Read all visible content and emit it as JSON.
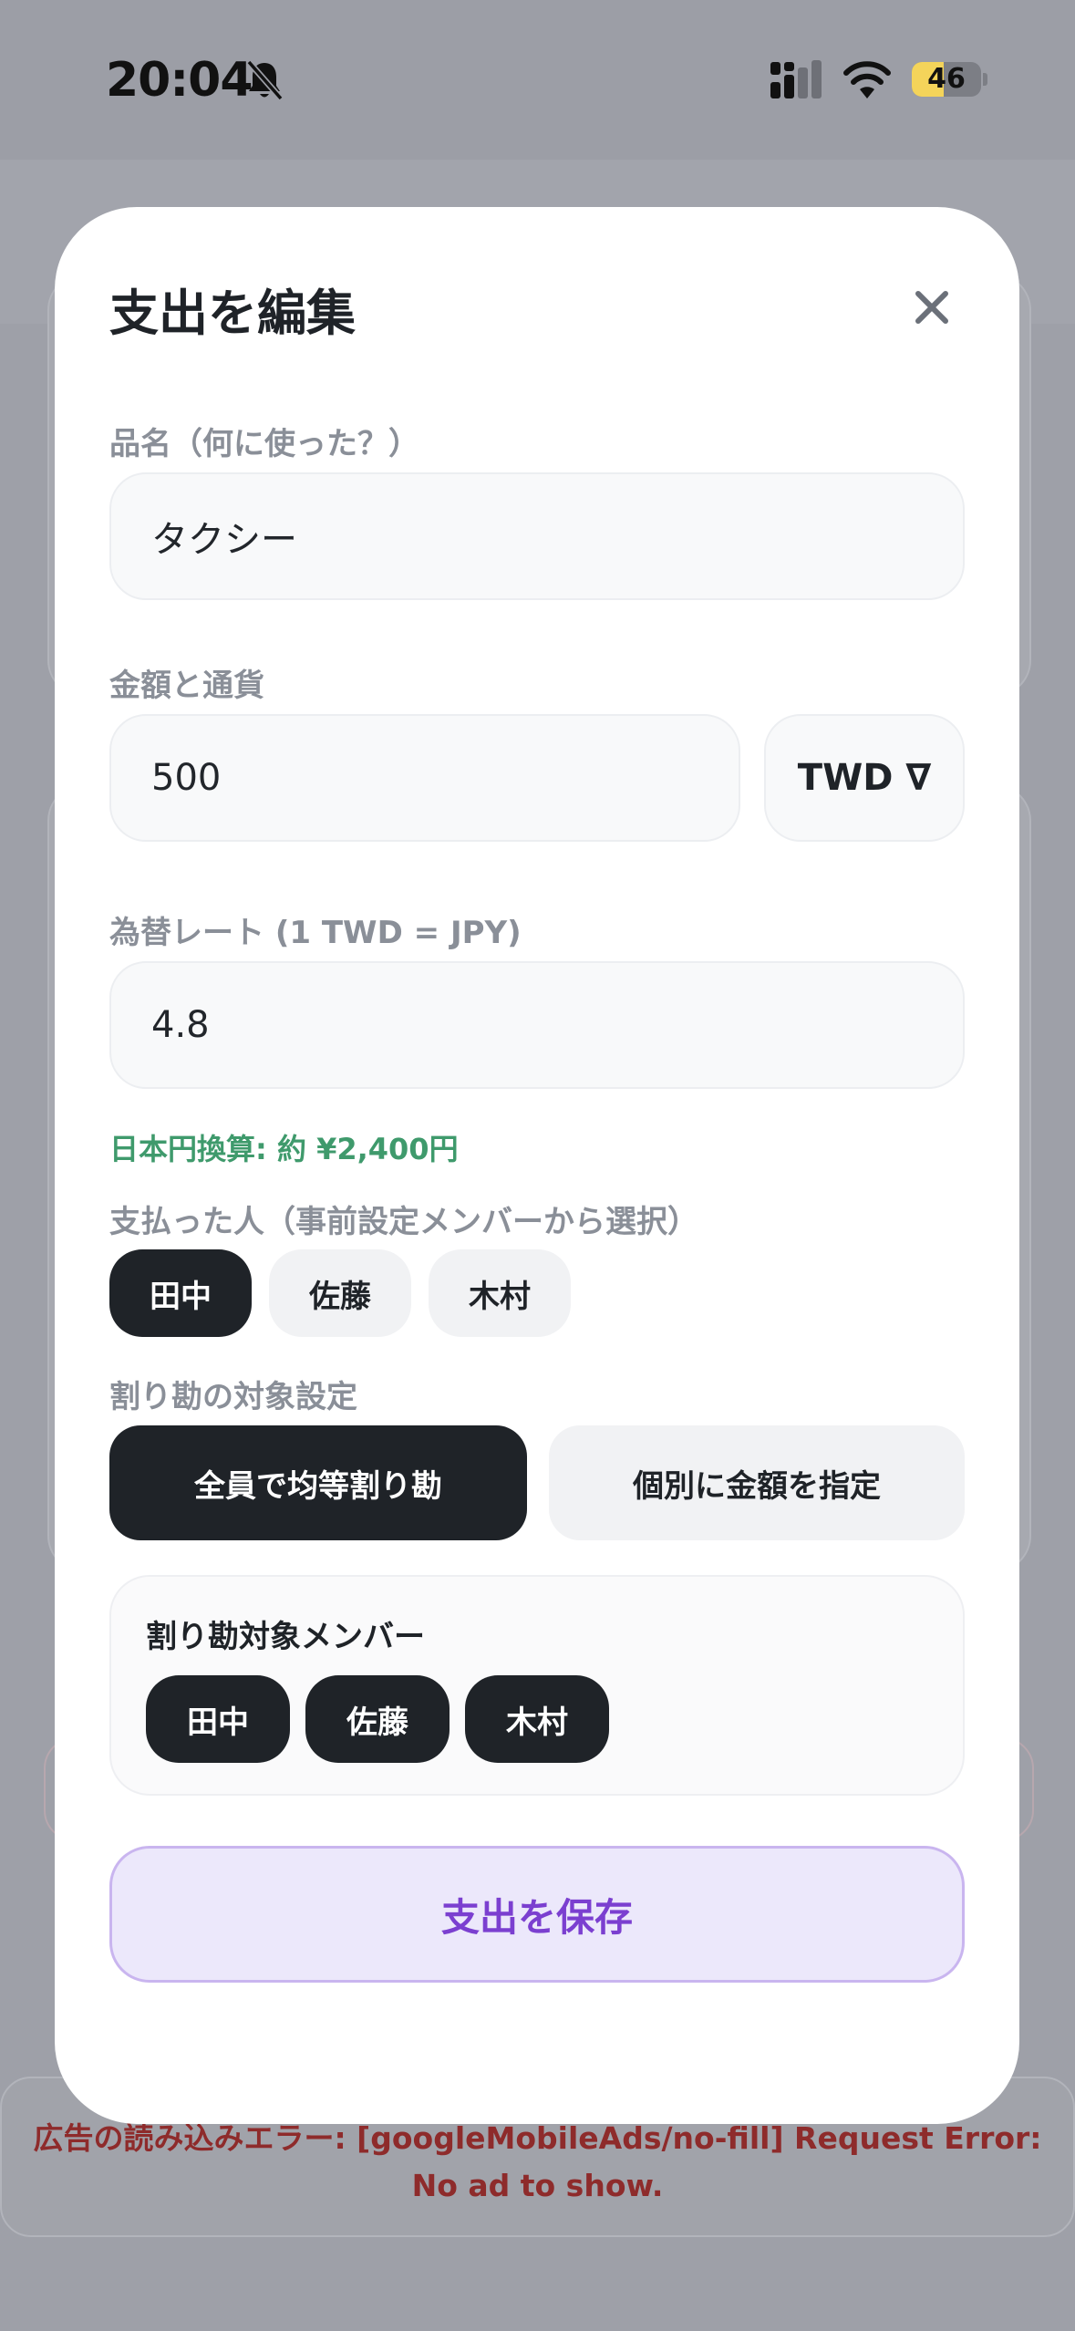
{
  "status_bar": {
    "time": "20:04",
    "battery": "46",
    "battery_level": 0.46
  },
  "background": {
    "error_banner": "広告の読み込みエラー: [googleMobileAds/no-fill] Request Error: No ad to show."
  },
  "modal": {
    "title": "支出を編集",
    "item_name": {
      "label": "品名（何に使った？）",
      "value": "タクシー"
    },
    "amount": {
      "label": "金額と通貨",
      "value": "500",
      "currency": "TWD ∇"
    },
    "rate": {
      "label": "為替レート (1 TWD = JPY)",
      "value": "4.8"
    },
    "conversion": "日本円換算: 約 ¥2,400円",
    "payer": {
      "label": "支払った人（事前設定メンバーから選択）",
      "options": [
        "田中",
        "佐藤",
        "木村"
      ],
      "selected": "田中"
    },
    "split": {
      "label": "割り勘の対象設定",
      "equal_label": "全員で均等割り勘",
      "custom_label": "個別に金額を指定",
      "selected": "equal"
    },
    "members": {
      "title": "割り勘対象メンバー",
      "items": [
        "田中",
        "佐藤",
        "木村"
      ]
    },
    "save_label": "支出を保存"
  },
  "colors": {
    "accent_purple": "#7b3fd0",
    "dark_chip": "#1f2328",
    "conversion_green": "#3f9a6c",
    "battery_yellow": "#f4d45a"
  }
}
